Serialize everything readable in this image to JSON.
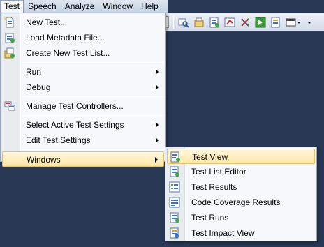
{
  "menubar": {
    "items": [
      {
        "label": "Test",
        "active": true
      },
      {
        "label": "Speech"
      },
      {
        "label": "Analyze"
      },
      {
        "label": "Window"
      },
      {
        "label": "Help"
      }
    ]
  },
  "toolbar": {
    "icons": [
      "search-test-icon",
      "test-settings-icon",
      "test-list-icon",
      "code-coverage-icon",
      "tools-icon",
      "run-test-icon",
      "test-impact-icon",
      "window-icon",
      "overflow-dropdown-icon"
    ]
  },
  "test_menu": {
    "items": [
      {
        "label": "New Test...",
        "icon": "new-test-icon"
      },
      {
        "label": "Load Metadata File...",
        "icon": "load-metadata-icon"
      },
      {
        "label": "Create New Test List...",
        "icon": "new-test-list-icon"
      },
      {
        "label": "Run",
        "submenu": true
      },
      {
        "label": "Debug",
        "submenu": true
      },
      {
        "label": "Manage Test Controllers...",
        "icon": "test-controllers-icon"
      },
      {
        "label": "Select Active Test Settings",
        "submenu": true
      },
      {
        "label": "Edit Test Settings",
        "submenu": true
      },
      {
        "label": "Windows",
        "submenu": true,
        "highlighted": true
      }
    ]
  },
  "windows_submenu": {
    "items": [
      {
        "label": "Test View",
        "icon": "test-view-icon",
        "highlighted": true
      },
      {
        "label": "Test List Editor",
        "icon": "test-list-editor-icon"
      },
      {
        "label": "Test Results",
        "icon": "test-results-icon"
      },
      {
        "label": "Code Coverage Results",
        "icon": "code-coverage-icon"
      },
      {
        "label": "Test Runs",
        "icon": "test-runs-icon"
      },
      {
        "label": "Test Impact View",
        "icon": "test-impact-icon"
      }
    ]
  },
  "colors": {
    "workspace": "#293955",
    "menu_bg": "#f7f8fb",
    "highlight": "#ffe8a6",
    "highlight_border": "#e5c365"
  }
}
